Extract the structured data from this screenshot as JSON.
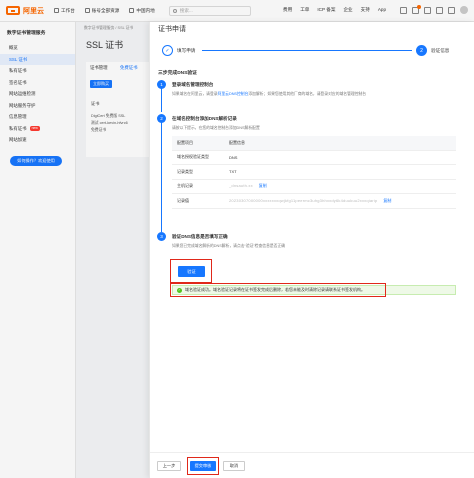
{
  "topbar": {
    "logo_text": "阿里云",
    "workbench": "工作台",
    "account": "账号全部资源",
    "region": "中国内地",
    "search_placeholder": "搜索...",
    "links": [
      "费用",
      "工单",
      "ICP 备案",
      "企业",
      "支持",
      "App"
    ],
    "colors": {
      "brand": "#ff6a00",
      "accent": "#1777ff"
    }
  },
  "sidebar": {
    "title": "数字证书管理服务",
    "items": [
      {
        "label": "概览"
      },
      {
        "label": "SSL 证书"
      },
      {
        "label": "私有证书"
      },
      {
        "label": "签名证书"
      },
      {
        "label": "网站运维检测"
      },
      {
        "label": "网站服务守护"
      },
      {
        "label": "信息管理"
      },
      {
        "label": "私有证书",
        "badge": "new"
      },
      {
        "label": "网站加速"
      }
    ],
    "cta": "如何操作？欢迎使用"
  },
  "middle": {
    "breadcrumb": "数字证书管理服务 / SSL 证书",
    "title": "SSL 证书",
    "tabs": [
      "证书管理",
      "免费证书"
    ],
    "button": "立即购买",
    "label": "证书",
    "rows": [
      "DigiCert 免费版 SSL",
      "测试 cert-kevin-hfvrc6",
      "免费证书"
    ]
  },
  "drawer": {
    "title": "证书申请",
    "steps": [
      {
        "num": "✓",
        "label": "填写申请"
      },
      {
        "num": "2",
        "label": "验证信息"
      }
    ],
    "section_heading": "三步完成DNS验证",
    "sec1": {
      "num": "1",
      "title": "登录域名管理控制台",
      "desc_prefix": "如果域名在阿里云，请登录",
      "desc_link": "阿里云DNS控制台",
      "desc_suffix": "添加解析；如果您使用其他厂商的域名，请登录对应的域名管理控制台"
    },
    "sec2": {
      "num": "2",
      "title": "在域名控制台添加DNS解析记录",
      "desc": "请按以下提示，在您的域名控制台添加DNS解析配置"
    },
    "table": {
      "headers": [
        "配置项目",
        "配置信息"
      ],
      "rows": [
        {
          "key": "域名授权验证类型",
          "value": "DNS",
          "copy": ""
        },
        {
          "key": "记录类型",
          "value": "TXT",
          "copy": "复制"
        },
        {
          "key": "主机记录",
          "value": "_dnsauth.xx",
          "copy": "复制"
        },
        {
          "key": "记录值",
          "value": "20230307000000xxxxxxxqwjkfg11peermc3uhg3hhxxdy6k4duukuu2xxxqiarip",
          "copy": "复制"
        }
      ]
    },
    "sec3": {
      "num": "3",
      "title": "验证DNS信息是否填写正确",
      "desc": "如果您已完成域名解析的DNS解析，请点击“验证”检查信息是否正确"
    },
    "verify_button": "验证",
    "success_message": "域名验证成功。域名验证记录将在证书签发完成后删除，若您未能及时清除记录请联系证书签发机构。",
    "footer": {
      "prev": "上一步",
      "submit": "提交审核",
      "cancel": "取消"
    }
  }
}
